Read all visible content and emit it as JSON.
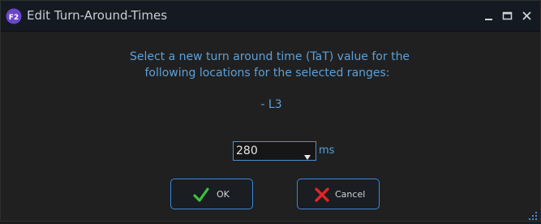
{
  "window": {
    "title": "Edit Turn-Around-Times",
    "app_icon": "f2-app-icon",
    "controls": [
      "minimize-icon",
      "maximize-icon",
      "close-icon"
    ]
  },
  "message": {
    "line1": "Select a new turn around time (TaT) value for the",
    "line2": "following locations for the selected ranges:",
    "location": "- L3"
  },
  "tat": {
    "value": "280",
    "unit": "ms"
  },
  "buttons": {
    "ok_label": "OK",
    "cancel_label": "Cancel"
  },
  "colors": {
    "accent": "#3f88d8",
    "text_blue": "#5aa0db",
    "background": "#202020",
    "titlebar": "#151a22"
  }
}
